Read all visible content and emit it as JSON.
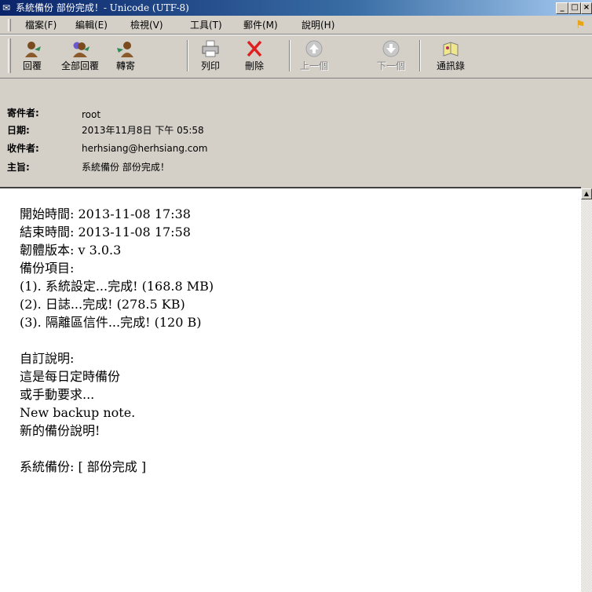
{
  "window": {
    "title": "系統備份 部份完成！- Unicode (UTF-8)",
    "min": "_",
    "max": "□",
    "close": "×"
  },
  "menu": [
    "檔案(F)",
    "編輯(E)",
    "檢視(V)",
    "工具(T)",
    "郵件(M)",
    "說明(H)"
  ],
  "toolbar": {
    "reply": "回覆",
    "reply_all": "全部回覆",
    "forward": "轉寄",
    "print": "列印",
    "delete": "刪除",
    "previous": "上一個",
    "next": "下一個",
    "address_book": "通訊錄"
  },
  "header": {
    "from_label": "寄件者:",
    "from": "root",
    "date_label": "日期:",
    "date": "2013年11月8日 下午 05:58",
    "to_label": "收件者:",
    "to": "herhsiang@herhsiang.com",
    "subject_label": "主旨:",
    "subject": "系統備份 部份完成！"
  },
  "body": [
    "開始時間: 2013-11-08  17:38",
    "結束時間: 2013-11-08  17:58",
    "韌體版本: v 3.0.3",
    "備份項目:",
    " (1). 系統設定...完成! (168.8 MB)",
    " (2). 日誌...完成! (278.5 KB)",
    " (3). 隔離區信件...完成! (120 B)",
    "",
    "自訂說明:",
    "這是每日定時備份",
    "或手動要求...",
    "New backup note.",
    "新的備份說明!",
    "",
    "系統備份: [ 部份完成 ]"
  ],
  "colors": {
    "titlebar_start": "#0a246a",
    "titlebar_end": "#a6caf0",
    "delete_red": "#e02020",
    "reply_green": "#2e8b57"
  }
}
